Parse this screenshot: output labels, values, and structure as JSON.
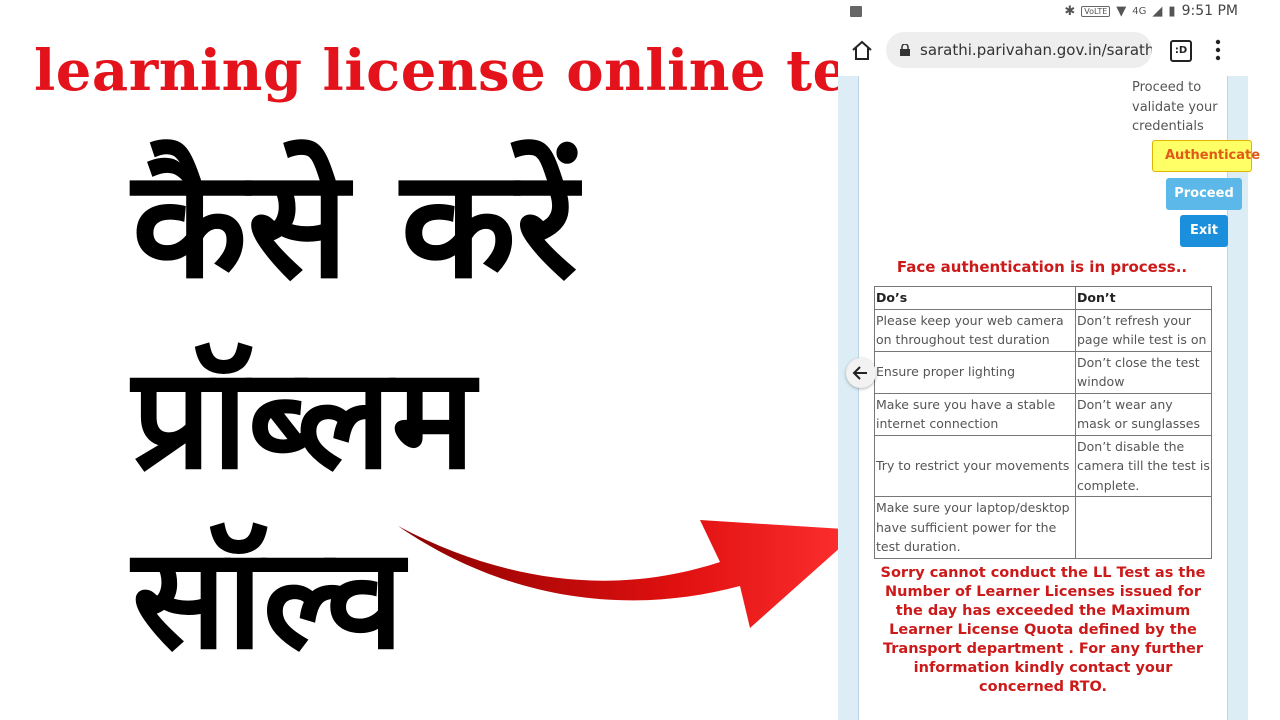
{
  "thumbnail": {
    "title": "learning license online test",
    "hindi_line1": "कैसे करें",
    "hindi_line2": "प्रॉब्लम",
    "hindi_line3": "सॉल्व"
  },
  "status_bar": {
    "network": "VoLTE",
    "signal_label": "4G",
    "time": "9:51 PM"
  },
  "browser": {
    "url": "sarathi.parivahan.gov.in/sarathis",
    "tabs_label": ":D"
  },
  "page": {
    "proceed_note": "Proceed to validate your credentials",
    "authenticate_label": "Authenticate",
    "proceed_label": "Proceed",
    "exit_label": "Exit",
    "face_auth_message": "Face authentication is in process..",
    "rules_table": {
      "headers": [
        "Do’s",
        "Don’t"
      ],
      "rows": [
        [
          "Please keep your web camera on throughout test duration",
          "Don’t refresh your page while test is on"
        ],
        [
          "Ensure proper lighting",
          "Don’t close the test window"
        ],
        [
          "Make sure you have a stable internet connection",
          "Don’t wear any mask or sunglasses"
        ],
        [
          "Try to restrict your movements",
          "Don’t disable the camera till the test is complete."
        ],
        [
          "Make sure your laptop/desktop have sufficient power for the test duration.",
          ""
        ]
      ]
    },
    "error_message": "Sorry cannot conduct the LL Test as the Number of Learner Licenses issued for the day has exceeded the Maximum Learner License Quota defined by the Transport department . For any further information kindly contact your concerned RTO."
  },
  "colors": {
    "title_red": "#e3121b",
    "error_red": "#cc1a1a",
    "authenticate_bg": "#ffff66",
    "proceed_bg": "#5bb8e8",
    "exit_bg": "#1b8fdb"
  }
}
